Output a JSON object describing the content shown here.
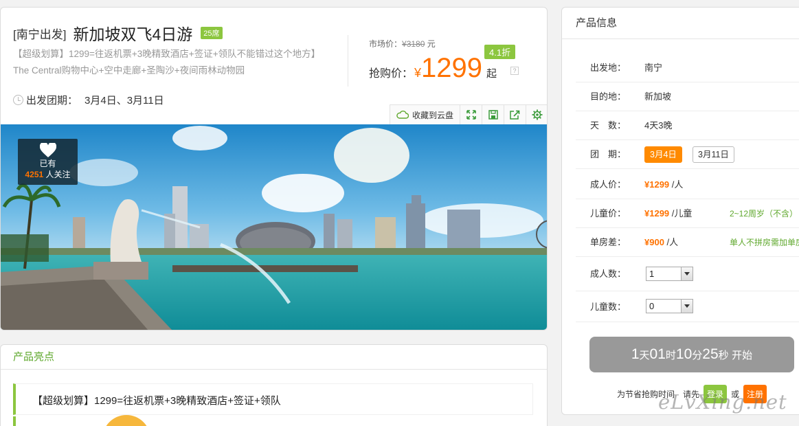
{
  "product": {
    "origin": "[南宁出发]",
    "title": "新加坡双飞4日游",
    "seats_badge": "25席",
    "description": "【超级划算】1299=往返机票+3晚精致酒店+签证+领队不能错过这个地方】The Central购物中心+空中走廊+圣陶沙+夜间雨林动物园",
    "departure_label": "出发团期：",
    "departure_dates": "3月4日、3月11日"
  },
  "pricing": {
    "market_label": "市场价：",
    "market_price": "¥3180",
    "market_unit": "元",
    "discount": "4.1折",
    "grab_label": "抢购价：",
    "currency": "¥",
    "price": "1299",
    "suffix": "起",
    "help": "?"
  },
  "toolbar": {
    "save_cloud_label": "收藏到云盘",
    "icons": [
      "cloud-icon",
      "expand-icon",
      "save-icon",
      "share-icon",
      "gear-icon"
    ]
  },
  "hero": {
    "fav_label": "已有",
    "fav_count": "4251",
    "fav_suffix": "人关注"
  },
  "highlights": {
    "title": "产品亮点",
    "item1": "【超级划算】1299=往返机票+3晚精致酒店+签证+领队"
  },
  "info": {
    "title": "产品信息",
    "rows": [
      {
        "label": "出发地：",
        "value": "南宁"
      },
      {
        "label": "目的地：",
        "value": "新加坡"
      },
      {
        "label": "天　数：",
        "value": "4天3晚"
      },
      {
        "label": "团　期：",
        "dates": [
          "3月4日",
          "3月11日"
        ],
        "selected": "3月4日"
      },
      {
        "label": "成人价：",
        "price": "¥1299",
        "unit": "/人"
      },
      {
        "label": "儿童价：",
        "price": "¥1299",
        "unit": "/儿童",
        "note": "2~12周岁（不含）"
      },
      {
        "label": "单房差：",
        "price": "¥900",
        "unit": "/人",
        "note": "单人不拼房需加单房"
      },
      {
        "label": "成人数：",
        "select_value": "1"
      },
      {
        "label": "儿童数：",
        "select_value": "0"
      }
    ],
    "countdown": {
      "days": "1",
      "days_unit": "天",
      "hours": "01",
      "hours_unit": "时",
      "minutes": "10",
      "minutes_unit": "分",
      "seconds": "25",
      "seconds_unit": "秒",
      "start": "开始"
    },
    "login_prompt": "为节省抢购时间　请先",
    "login_button": "登录",
    "or": "或",
    "register_button": "注册"
  },
  "watermark": "eLvXing.net",
  "colors": {
    "accent_orange": "#ff7200",
    "accent_green": "#8cc63f",
    "countdown_bg": "#999999"
  }
}
